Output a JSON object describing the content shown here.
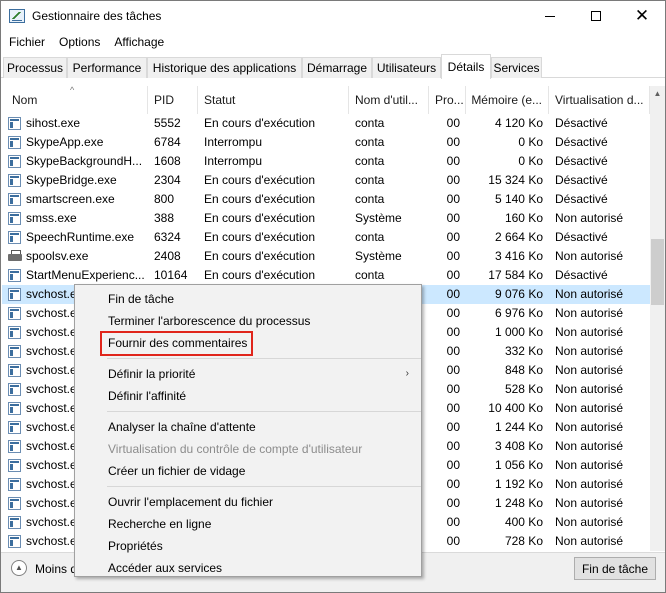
{
  "window": {
    "title": "Gestionnaire des tâches",
    "minimize_icon": "minimize-icon",
    "maximize_icon": "maximize-icon",
    "close_icon": "close-icon",
    "close_glyph": "✕"
  },
  "menubar": {
    "items": [
      "Fichier",
      "Options",
      "Affichage"
    ]
  },
  "tabs": {
    "active": "Détails",
    "items": [
      "Processus",
      "Performance",
      "Historique des applications",
      "Démarrage",
      "Utilisateurs",
      "Détails",
      "Services"
    ]
  },
  "table": {
    "sort_indicator": "^",
    "columns": [
      "Nom",
      "PID",
      "Statut",
      "Nom d'util...",
      "Pro...",
      "Mémoire (e...",
      "Virtualisation d..."
    ],
    "rows": [
      {
        "name": "sihost.exe",
        "pid": "5552",
        "status": "En cours d'exécution",
        "user": "conta",
        "cpu": "00",
        "memory": "4 120 Ko",
        "virt": "Désactivé",
        "icon": "process-icon"
      },
      {
        "name": "SkypeApp.exe",
        "pid": "6784",
        "status": "Interrompu",
        "user": "conta",
        "cpu": "00",
        "memory": "0 Ko",
        "virt": "Désactivé",
        "icon": "process-icon"
      },
      {
        "name": "SkypeBackgroundH...",
        "pid": "1608",
        "status": "Interrompu",
        "user": "conta",
        "cpu": "00",
        "memory": "0 Ko",
        "virt": "Désactivé",
        "icon": "process-icon"
      },
      {
        "name": "SkypeBridge.exe",
        "pid": "2304",
        "status": "En cours d'exécution",
        "user": "conta",
        "cpu": "00",
        "memory": "15 324 Ko",
        "virt": "Désactivé",
        "icon": "process-icon"
      },
      {
        "name": "smartscreen.exe",
        "pid": "800",
        "status": "En cours d'exécution",
        "user": "conta",
        "cpu": "00",
        "memory": "5 140 Ko",
        "virt": "Désactivé",
        "icon": "process-icon"
      },
      {
        "name": "smss.exe",
        "pid": "388",
        "status": "En cours d'exécution",
        "user": "Système",
        "cpu": "00",
        "memory": "160 Ko",
        "virt": "Non autorisé",
        "icon": "process-icon"
      },
      {
        "name": "SpeechRuntime.exe",
        "pid": "6324",
        "status": "En cours d'exécution",
        "user": "conta",
        "cpu": "00",
        "memory": "2 664 Ko",
        "virt": "Désactivé",
        "icon": "process-icon"
      },
      {
        "name": "spoolsv.exe",
        "pid": "2408",
        "status": "En cours d'exécution",
        "user": "Système",
        "cpu": "00",
        "memory": "3 416 Ko",
        "virt": "Non autorisé",
        "icon": "printer-icon"
      },
      {
        "name": "StartMenuExperienc...",
        "pid": "10164",
        "status": "En cours d'exécution",
        "user": "conta",
        "cpu": "00",
        "memory": "17 584 Ko",
        "virt": "Désactivé",
        "icon": "process-icon"
      },
      {
        "name": "svchost.exe",
        "pid": "",
        "status": "",
        "user": "",
        "cpu": "00",
        "memory": "9 076 Ko",
        "virt": "Non autorisé",
        "icon": "process-icon",
        "selected": true
      },
      {
        "name": "svchost.exe",
        "pid": "",
        "status": "",
        "user": "",
        "cpu": "00",
        "memory": "6 976 Ko",
        "virt": "Non autorisé",
        "icon": "process-icon"
      },
      {
        "name": "svchost.exe",
        "pid": "",
        "status": "",
        "user": "",
        "cpu": "00",
        "memory": "1 000 Ko",
        "virt": "Non autorisé",
        "icon": "process-icon"
      },
      {
        "name": "svchost.exe",
        "pid": "",
        "status": "",
        "user": "",
        "cpu": "00",
        "memory": "332 Ko",
        "virt": "Non autorisé",
        "icon": "process-icon"
      },
      {
        "name": "svchost.exe",
        "pid": "",
        "status": "",
        "user": "",
        "cpu": "00",
        "memory": "848 Ko",
        "virt": "Non autorisé",
        "icon": "process-icon"
      },
      {
        "name": "svchost.exe",
        "pid": "",
        "status": "",
        "user": "",
        "cpu": "00",
        "memory": "528 Ko",
        "virt": "Non autorisé",
        "icon": "process-icon"
      },
      {
        "name": "svchost.exe",
        "pid": "",
        "status": "",
        "user": "",
        "cpu": "00",
        "memory": "10 400 Ko",
        "virt": "Non autorisé",
        "icon": "process-icon"
      },
      {
        "name": "svchost.exe",
        "pid": "",
        "status": "",
        "user": "",
        "cpu": "00",
        "memory": "1 244 Ko",
        "virt": "Non autorisé",
        "icon": "process-icon"
      },
      {
        "name": "svchost.exe",
        "pid": "",
        "status": "",
        "user": "",
        "cpu": "00",
        "memory": "3 408 Ko",
        "virt": "Non autorisé",
        "icon": "process-icon"
      },
      {
        "name": "svchost.exe",
        "pid": "",
        "status": "",
        "user": "",
        "cpu": "00",
        "memory": "1 056 Ko",
        "virt": "Non autorisé",
        "icon": "process-icon"
      },
      {
        "name": "svchost.exe",
        "pid": "",
        "status": "",
        "user": "",
        "cpu": "00",
        "memory": "1 192 Ko",
        "virt": "Non autorisé",
        "icon": "process-icon"
      },
      {
        "name": "svchost.exe",
        "pid": "",
        "status": "",
        "user": "",
        "cpu": "00",
        "memory": "1 248 Ko",
        "virt": "Non autorisé",
        "icon": "process-icon"
      },
      {
        "name": "svchost.exe",
        "pid": "",
        "status": "",
        "user": "",
        "cpu": "00",
        "memory": "400 Ko",
        "virt": "Non autorisé",
        "icon": "process-icon"
      },
      {
        "name": "svchost.exe",
        "pid": "",
        "status": "",
        "user": "",
        "cpu": "00",
        "memory": "728 Ko",
        "virt": "Non autorisé",
        "icon": "process-icon"
      }
    ]
  },
  "context_menu": {
    "items": [
      {
        "label": "Fin de tâche",
        "disabled": false
      },
      {
        "label": "Terminer l'arborescence du processus",
        "disabled": false
      },
      {
        "label": "Fournir des commentaires",
        "disabled": false,
        "highlighted": true
      },
      {
        "separator": true
      },
      {
        "label": "Définir la priorité",
        "disabled": false,
        "submenu": true
      },
      {
        "label": "Définir l'affinité",
        "disabled": false
      },
      {
        "separator": true
      },
      {
        "label": "Analyser la chaîne d'attente",
        "disabled": false
      },
      {
        "label": "Virtualisation du contrôle de compte d'utilisateur",
        "disabled": true
      },
      {
        "label": "Créer un fichier de vidage",
        "disabled": false
      },
      {
        "separator": true
      },
      {
        "label": "Ouvrir l'emplacement du fichier",
        "disabled": false
      },
      {
        "label": "Recherche en ligne",
        "disabled": false
      },
      {
        "label": "Propriétés",
        "disabled": false
      },
      {
        "label": "Accéder aux services",
        "disabled": false
      }
    ],
    "submenu_arrow": "›",
    "highlight_color": "#e0251b"
  },
  "footer": {
    "less_details_label": "Moins d",
    "less_icon": "chevron-up-circle-icon",
    "less_glyph": "︿",
    "end_task_label": "Fin de tâche"
  },
  "colors": {
    "selection": "#cce8ff",
    "highlight_border": "#e0251b"
  }
}
